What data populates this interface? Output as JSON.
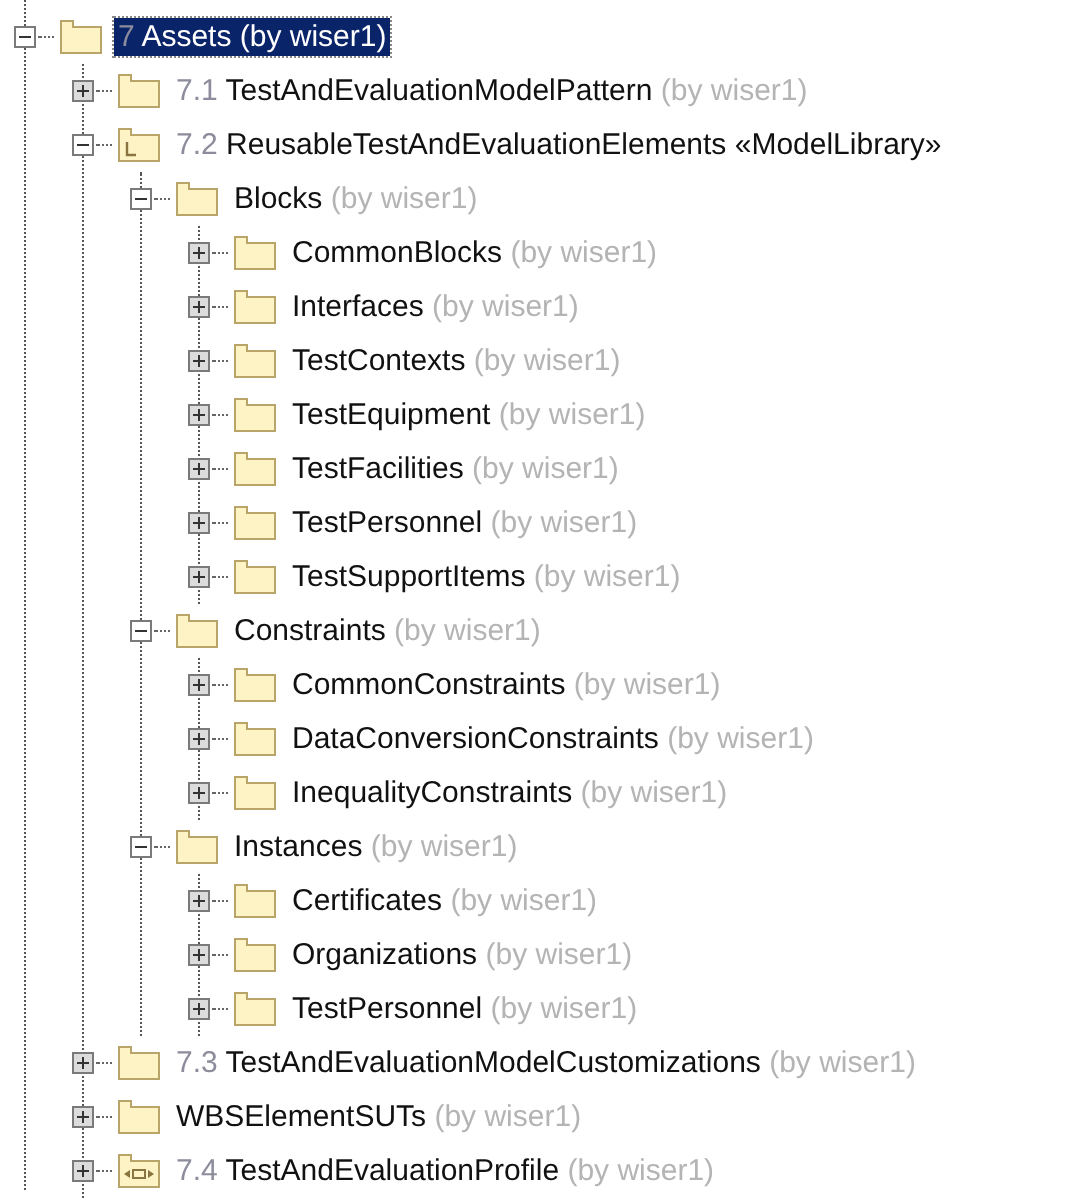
{
  "tree": [
    {
      "number": "7",
      "name": "Assets",
      "owner": "(by wiser1)",
      "kind": "folder",
      "expanded": true,
      "selected": true,
      "children": [
        {
          "number": "7.1",
          "name": "TestAndEvaluationModelPattern",
          "owner": "(by wiser1)",
          "kind": "folder",
          "expanded": false,
          "selected": false
        },
        {
          "number": "7.2",
          "name": "ReusableTestAndEvaluationElements",
          "stereotype": "«ModelLibrary»",
          "kind": "library",
          "expanded": true,
          "selected": false,
          "children": [
            {
              "name": "Blocks",
              "owner": "(by wiser1)",
              "kind": "folder",
              "expanded": true,
              "selected": false,
              "children": [
                {
                  "name": "CommonBlocks",
                  "owner": "(by wiser1)",
                  "kind": "folder",
                  "expanded": false,
                  "selected": false
                },
                {
                  "name": "Interfaces",
                  "owner": "(by wiser1)",
                  "kind": "folder",
                  "expanded": false,
                  "selected": false
                },
                {
                  "name": "TestContexts",
                  "owner": "(by wiser1)",
                  "kind": "folder",
                  "expanded": false,
                  "selected": false
                },
                {
                  "name": "TestEquipment",
                  "owner": "(by wiser1)",
                  "kind": "folder",
                  "expanded": false,
                  "selected": false
                },
                {
                  "name": "TestFacilities",
                  "owner": "(by wiser1)",
                  "kind": "folder",
                  "expanded": false,
                  "selected": false
                },
                {
                  "name": "TestPersonnel",
                  "owner": "(by wiser1)",
                  "kind": "folder",
                  "expanded": false,
                  "selected": false
                },
                {
                  "name": "TestSupportItems",
                  "owner": "(by wiser1)",
                  "kind": "folder",
                  "expanded": false,
                  "selected": false
                }
              ]
            },
            {
              "name": "Constraints",
              "owner": "(by wiser1)",
              "kind": "folder",
              "expanded": true,
              "selected": false,
              "children": [
                {
                  "name": "CommonConstraints",
                  "owner": "(by wiser1)",
                  "kind": "folder",
                  "expanded": false,
                  "selected": false
                },
                {
                  "name": "DataConversionConstraints",
                  "owner": "(by wiser1)",
                  "kind": "folder",
                  "expanded": false,
                  "selected": false
                },
                {
                  "name": "InequalityConstraints",
                  "owner": "(by wiser1)",
                  "kind": "folder",
                  "expanded": false,
                  "selected": false
                }
              ]
            },
            {
              "name": "Instances",
              "owner": "(by wiser1)",
              "kind": "folder",
              "expanded": true,
              "selected": false,
              "children": [
                {
                  "name": "Certificates",
                  "owner": "(by wiser1)",
                  "kind": "folder",
                  "expanded": false,
                  "selected": false
                },
                {
                  "name": "Organizations",
                  "owner": "(by wiser1)",
                  "kind": "folder",
                  "expanded": false,
                  "selected": false
                },
                {
                  "name": "TestPersonnel",
                  "owner": "(by wiser1)",
                  "kind": "folder",
                  "expanded": false,
                  "selected": false
                }
              ]
            }
          ]
        },
        {
          "number": "7.3",
          "name": "TestAndEvaluationModelCustomizations",
          "owner": "(by wiser1)",
          "kind": "folder",
          "expanded": false,
          "selected": false
        },
        {
          "name": "WBSElementSUTs",
          "owner": "(by wiser1)",
          "kind": "folder",
          "expanded": false,
          "selected": false
        },
        {
          "number": "7.4",
          "name": "TestAndEvaluationProfile",
          "owner": "(by wiser1)",
          "kind": "profile",
          "expanded": false,
          "selected": false
        }
      ]
    }
  ]
}
